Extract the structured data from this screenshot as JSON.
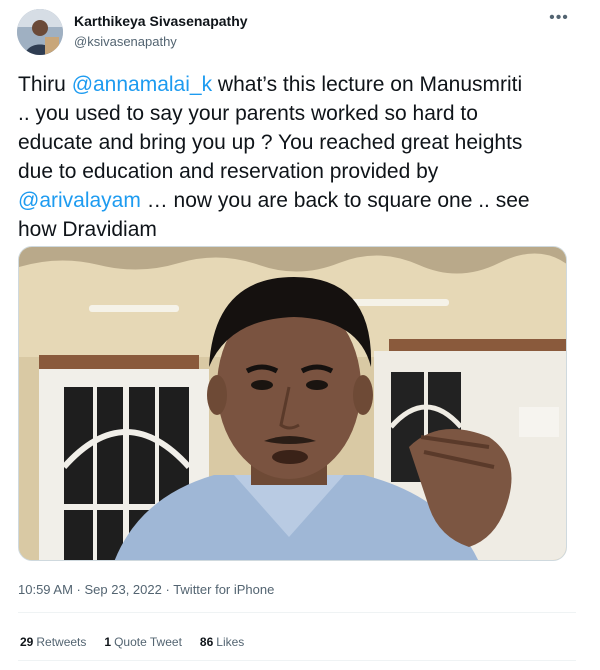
{
  "author": {
    "name": "Karthikeya Sivasenapathy",
    "handle": "@ksivasenapathy"
  },
  "tweet": {
    "t1": "Thiru ",
    "mention1": "@annamalai_k",
    "t2": " what’s this lecture on Manusmriti\n.. you used to say your parents worked so hard to\neducate and bring you up ? You reached great heights\ndue to education and reservation provided by\n",
    "mention2": "@arivalayam",
    "t3": " … now you are back to square one .. see\nhow Dravidiam"
  },
  "meta": {
    "time": "10:59 AM",
    "sep1": " · ",
    "date": "Sep 23, 2022",
    "sep2": " · ",
    "source": "Twitter for iPhone"
  },
  "stats": {
    "retweets_count": "29",
    "retweets_label": "Retweets",
    "quotes_count": "1",
    "quotes_label": "Quote Tweet",
    "likes_count": "86",
    "likes_label": "Likes"
  },
  "icons": {
    "more": "more-horizontal-icon",
    "avatar": "profile-photo"
  },
  "colors": {
    "link": "#1d9bf0",
    "text": "#0f1419",
    "secondary": "#536471"
  }
}
